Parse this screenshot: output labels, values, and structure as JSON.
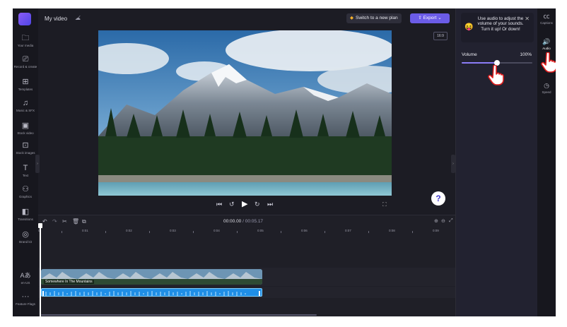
{
  "app": {
    "title": "My video"
  },
  "sidebar": {
    "items": [
      {
        "icon": "folder-icon",
        "glyph": "🗀",
        "label": "Your media"
      },
      {
        "icon": "record-icon",
        "glyph": "⎚",
        "label": "Record & create"
      },
      {
        "icon": "templates-icon",
        "glyph": "⊞",
        "label": "Templates"
      },
      {
        "icon": "music-icon",
        "glyph": "♫",
        "label": "Music & SFX"
      },
      {
        "icon": "stock-video-icon",
        "glyph": "▣",
        "label": "Stock video"
      },
      {
        "icon": "stock-images-icon",
        "glyph": "⊡",
        "label": "Stock images"
      },
      {
        "icon": "text-icon",
        "glyph": "T",
        "label": "Text"
      },
      {
        "icon": "graphics-icon",
        "glyph": "⚇",
        "label": "Graphics"
      },
      {
        "icon": "transitions-icon",
        "glyph": "◧",
        "label": "Transitions"
      },
      {
        "icon": "brand-kit-icon",
        "glyph": "◎",
        "label": "Brand kit"
      },
      {
        "icon": "language-icon",
        "glyph": "Aあ",
        "label": "en-US"
      },
      {
        "icon": "more-icon",
        "glyph": "···",
        "label": "Feature Flags"
      }
    ]
  },
  "topbar": {
    "plan_label": "Switch to a new plan",
    "export_label": "Export"
  },
  "preview": {
    "aspect_ratio": "16:9",
    "help_label": "?"
  },
  "timeline": {
    "current_time": "00:00.00",
    "total_time": "00:05.17",
    "ticks": [
      "0",
      "0:01",
      "0:02",
      "0:03",
      "0:04",
      "0:05",
      "0:06",
      "0:07",
      "0:08",
      "0:09"
    ],
    "video_clip_label": "Somewhere In The Mountains"
  },
  "audio_panel": {
    "tooltip_text": "Use audio to adjust the volume of your sounds. Turn it up! Or down!",
    "volume_label": "Volume",
    "volume_value": "100%",
    "volume_fraction": 0.5
  },
  "right_tabs": [
    {
      "icon": "captions-icon",
      "glyph": "㏄",
      "label": "Captions"
    },
    {
      "icon": "audio-icon",
      "glyph": "🔊",
      "label": "Audio"
    },
    {
      "icon": "speed-icon",
      "glyph": "◷",
      "label": "Speed"
    }
  ]
}
